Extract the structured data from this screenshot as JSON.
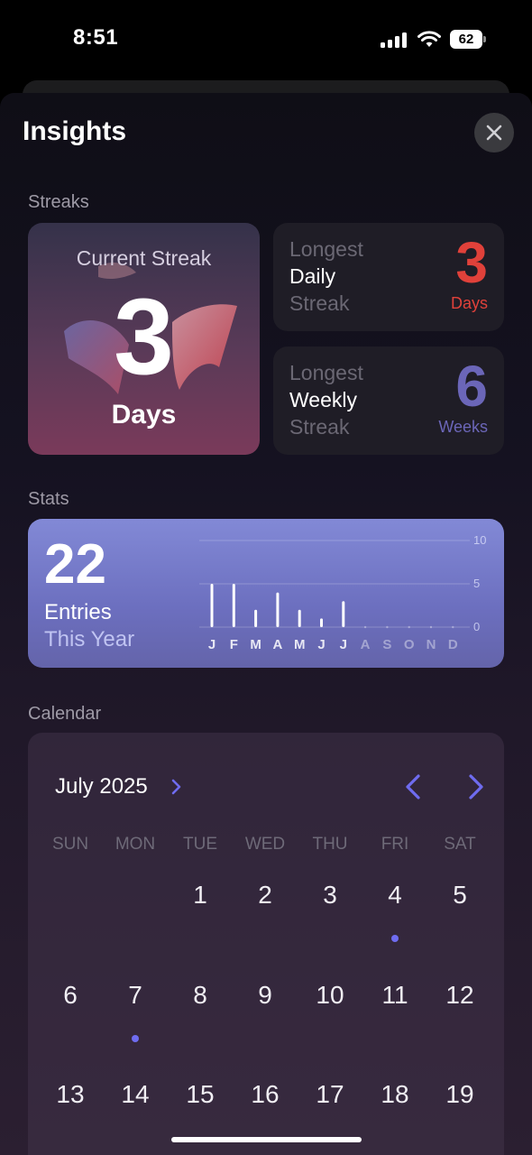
{
  "status_bar": {
    "time": "8:51",
    "battery": "62"
  },
  "sheet": {
    "title": "Insights"
  },
  "streaks": {
    "section_label": "Streaks",
    "current": {
      "label": "Current Streak",
      "value": "3",
      "unit": "Days"
    },
    "longest_daily": {
      "line1": "Longest",
      "line2": "Daily",
      "line3": "Streak",
      "value": "3",
      "unit": "Days",
      "color": "#e0413a"
    },
    "longest_weekly": {
      "line1": "Longest",
      "line2": "Weekly",
      "line3": "Streak",
      "value": "6",
      "unit": "Weeks",
      "color": "#6b66b8"
    }
  },
  "stats": {
    "section_label": "Stats",
    "count": "22",
    "line1": "Entries",
    "line2": "This Year"
  },
  "chart_data": {
    "type": "bar",
    "categories": [
      "J",
      "F",
      "M",
      "A",
      "M",
      "J",
      "J",
      "A",
      "S",
      "O",
      "N",
      "D"
    ],
    "values": [
      5,
      5,
      2,
      4,
      2,
      1,
      3,
      0,
      0,
      0,
      0,
      0
    ],
    "ylim": [
      0,
      10
    ],
    "yticks": [
      "10",
      "5",
      "0"
    ],
    "grid": true
  },
  "calendar": {
    "section_label": "Calendar",
    "month": "July 2025",
    "weekdays": [
      "SUN",
      "MON",
      "TUE",
      "WED",
      "THU",
      "FRI",
      "SAT"
    ],
    "weeks": [
      [
        "",
        "",
        "1",
        "2",
        "3",
        "4",
        "5"
      ],
      [
        "6",
        "7",
        "8",
        "9",
        "10",
        "11",
        "12"
      ],
      [
        "13",
        "14",
        "15",
        "16",
        "17",
        "18",
        "19"
      ]
    ],
    "entry_days": [
      "4",
      "7"
    ],
    "accent": "#6f6cf0"
  }
}
